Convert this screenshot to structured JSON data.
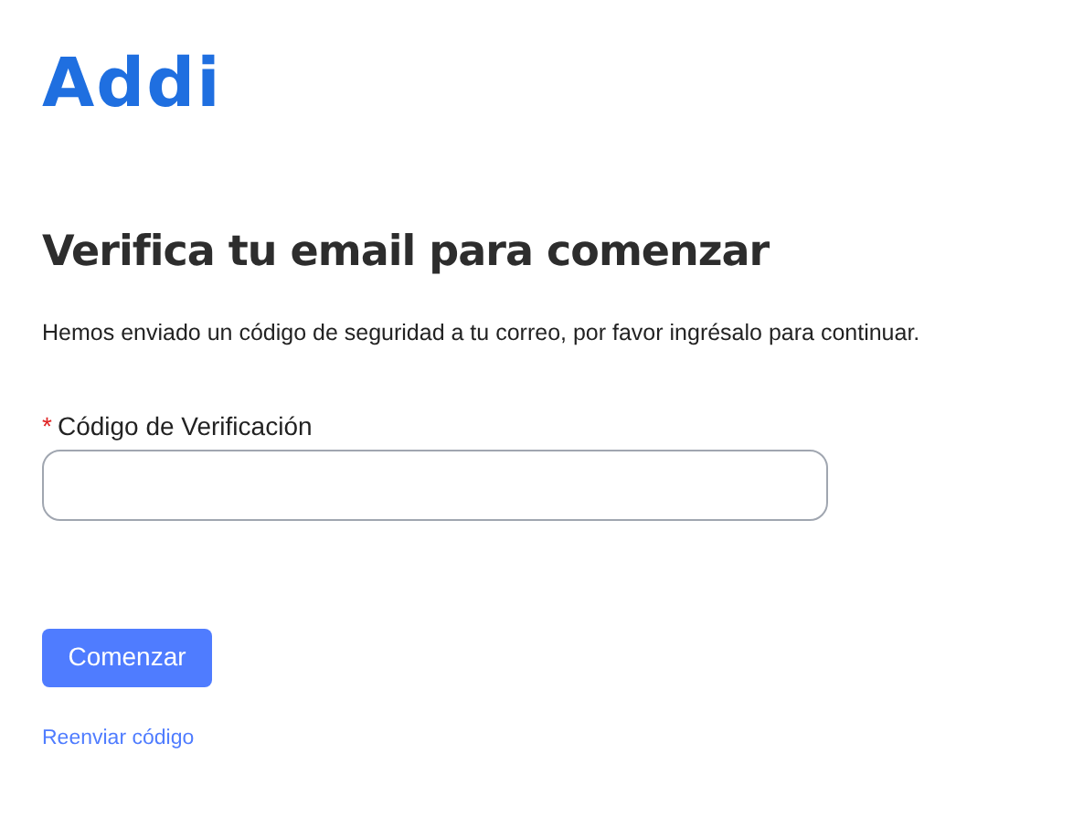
{
  "logo": "Addi",
  "title": "Verifica tu email para comenzar",
  "description": "Hemos enviado un código de seguridad a tu correo, por favor ingrésalo para continuar.",
  "field": {
    "label": "Código de Verificación",
    "required_mark": "*"
  },
  "button": "Comenzar",
  "link": "Reenviar código"
}
